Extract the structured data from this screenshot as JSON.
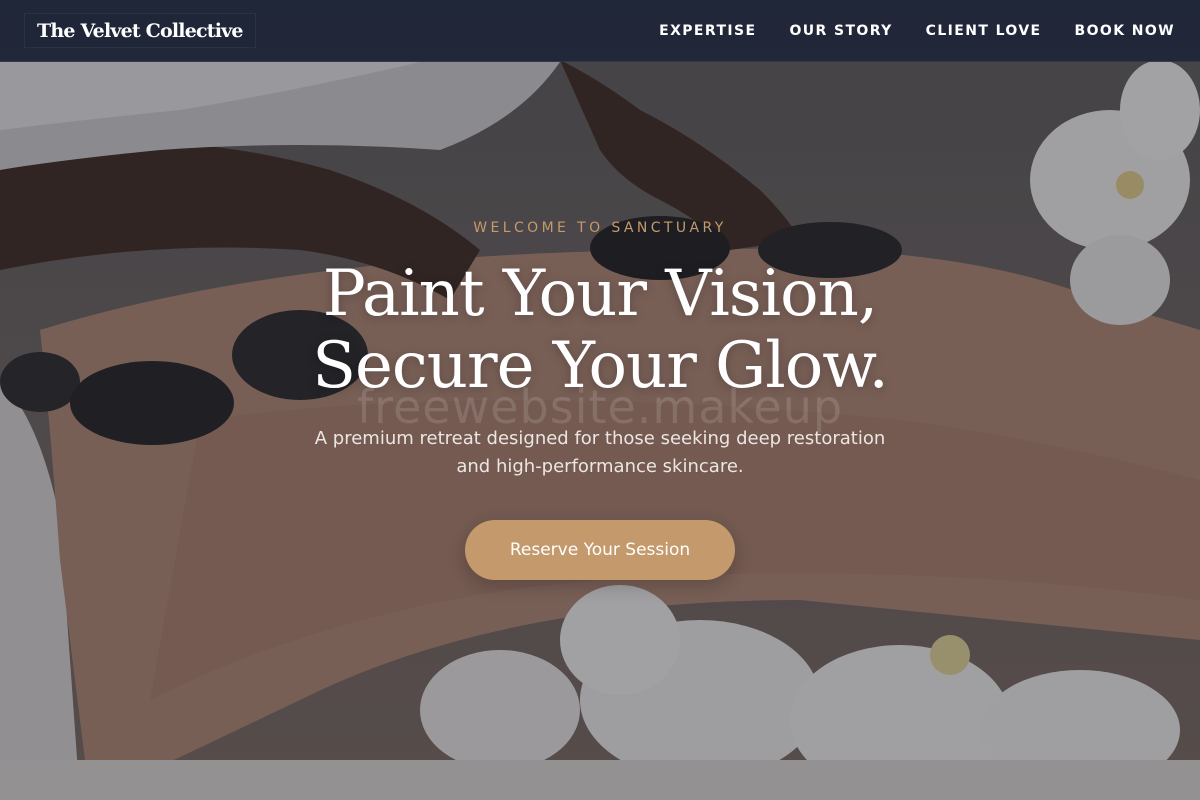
{
  "brand": {
    "name": "The Velvet Collective"
  },
  "nav": {
    "items": [
      {
        "label": "EXPERTISE"
      },
      {
        "label": "OUR STORY"
      },
      {
        "label": "CLIENT LOVE"
      },
      {
        "label": "BOOK NOW"
      }
    ]
  },
  "hero": {
    "eyebrow": "WELCOME TO SANCTUARY",
    "headline_line1": "Paint Your Vision,",
    "headline_line2": "Secure Your Glow.",
    "watermark": "freewebsite.makeup",
    "subtext_line1": "A premium retreat designed for those seeking deep restoration",
    "subtext_line2": "and high-performance skincare.",
    "cta_label": "Reserve Your Session"
  },
  "colors": {
    "navbar": "#1e2638",
    "accent_gold": "#c49a6c",
    "text_white": "#ffffff"
  }
}
